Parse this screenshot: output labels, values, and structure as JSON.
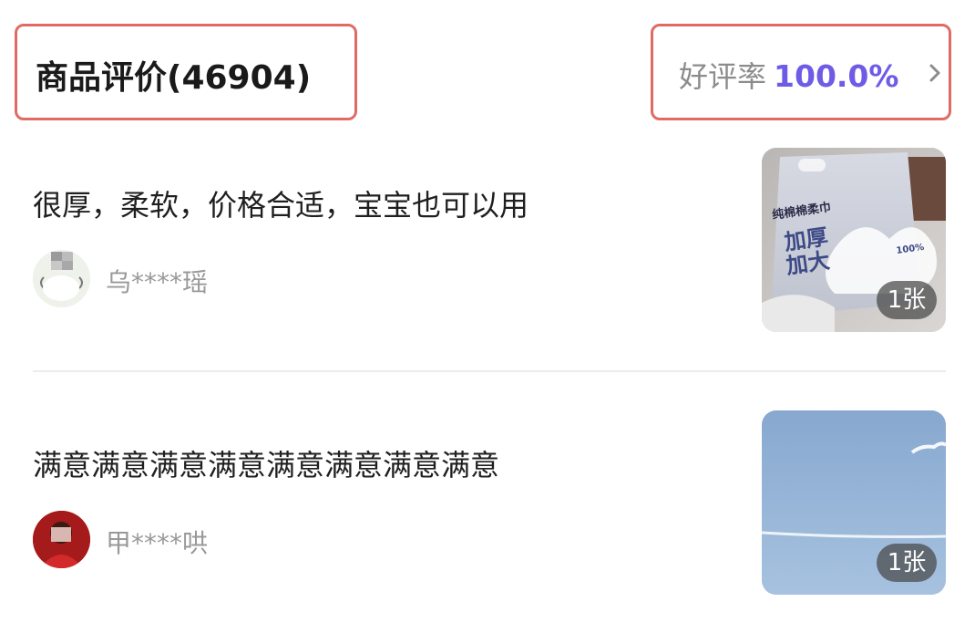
{
  "header": {
    "title": "商品评价(46904)",
    "rating_label": "好评率",
    "rating_value": "100.0%",
    "chevron_icon": "chevron-right-icon"
  },
  "reviews": [
    {
      "text": "很厚，柔软，价格合适，宝宝也可以用",
      "user": "乌****瑶",
      "image_count": "1张",
      "product_photo_text": {
        "brand_line": "纯棉棉柔巾",
        "big_text_1": "加厚",
        "big_text_2": "加大",
        "tag": "100%"
      }
    },
    {
      "text": "满意满意满意满意满意满意满意满意",
      "user": "甲****哄",
      "image_count": "1张"
    }
  ],
  "colors": {
    "highlight_border": "#e06b64",
    "rating_accent": "#6e5ce6",
    "muted_text": "#999999"
  }
}
